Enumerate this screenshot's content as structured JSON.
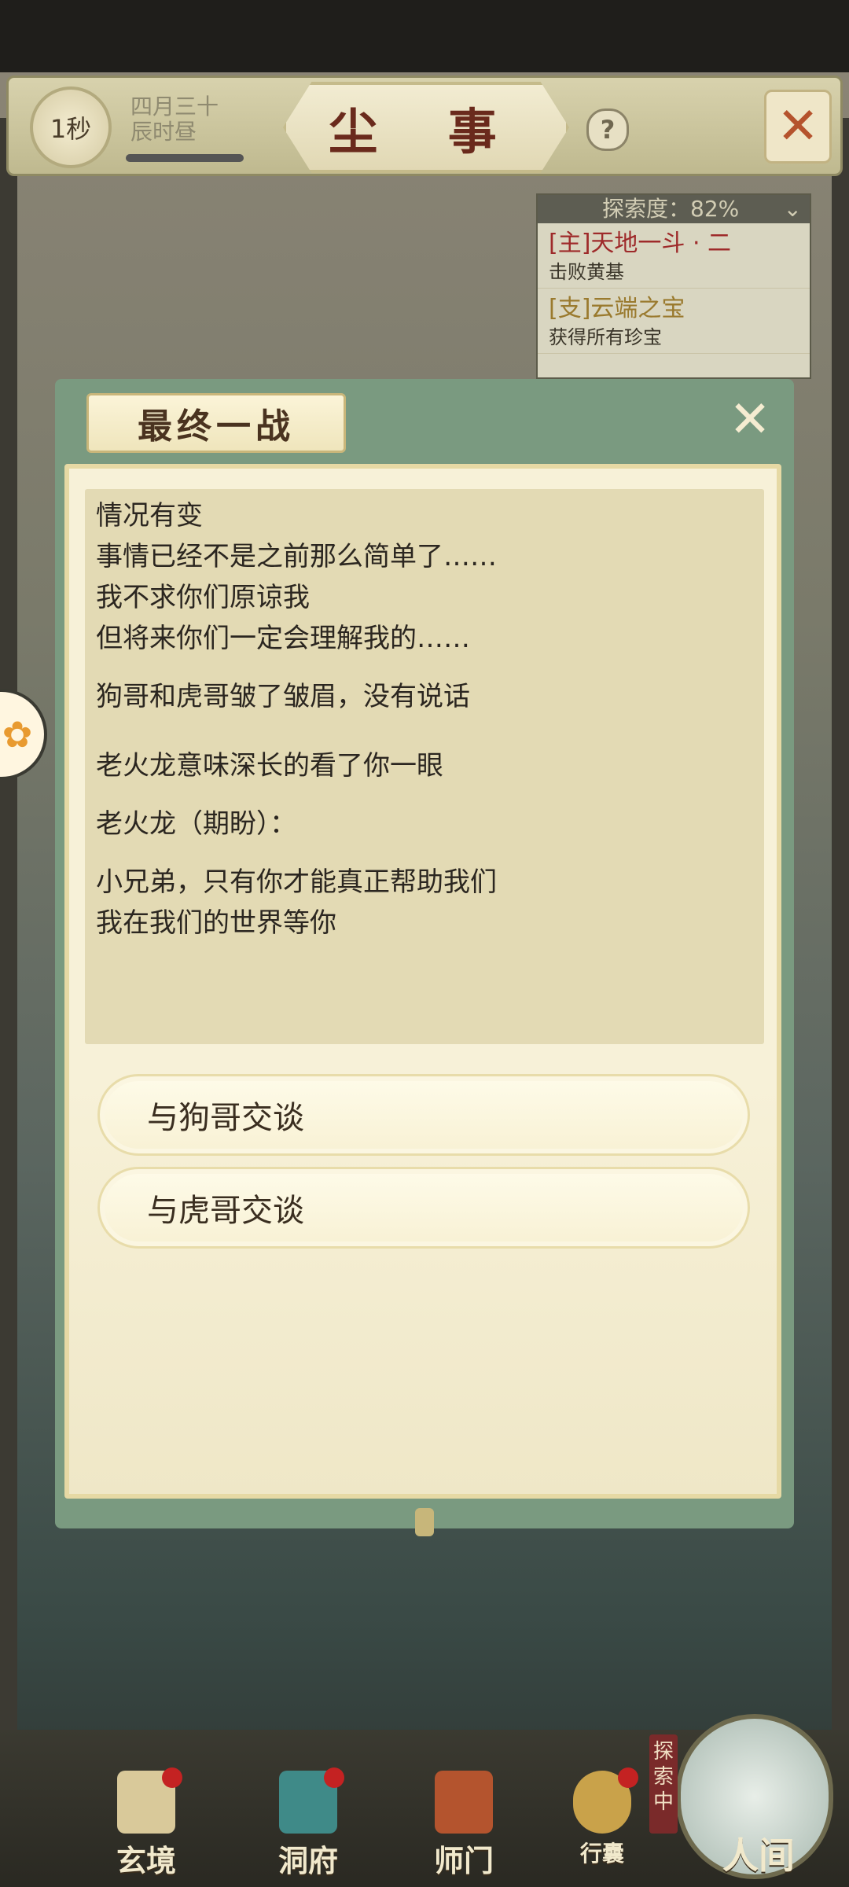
{
  "header": {
    "timer": "1秒",
    "date_line1": "四月三十",
    "date_line2": "辰时昼",
    "title": "尘 事",
    "help_icon": "?",
    "close_icon": "✕"
  },
  "quest_tracker": {
    "progress_label": "探索度：82%",
    "collapse_icon": "⌄",
    "items": [
      {
        "title": "[主]天地一斗 · 二",
        "desc": "击败黄基"
      },
      {
        "title": "[支]云端之宝",
        "desc": "获得所有珍宝"
      }
    ]
  },
  "side_bubble": {
    "icon": "gamepad-icon",
    "glyph": "✿"
  },
  "dialog": {
    "title": "最终一战",
    "close_glyph": "✕",
    "story": [
      "情况有变",
      "事情已经不是之前那么简单了……",
      "我不求你们原谅我",
      "但将来你们一定会理解我的……",
      "狗哥和虎哥皱了皱眉，没有说话",
      "老火龙意味深长的看了你一眼",
      "老火龙（期盼）：",
      "小兄弟，只有你才能真正帮助我们",
      "我在我们的世界等你"
    ],
    "choices": [
      "与狗哥交谈",
      "与虎哥交谈"
    ]
  },
  "bottom_nav": {
    "items": [
      "玄境",
      "洞府",
      "师门",
      "行囊"
    ],
    "explore_tag": "探索中",
    "world": "人间"
  },
  "colors": {
    "dialog_frame": "#7a9a80",
    "parchment": "#f7f1d8",
    "title_red": "#6a2a1c",
    "badge_red": "#c42222"
  }
}
